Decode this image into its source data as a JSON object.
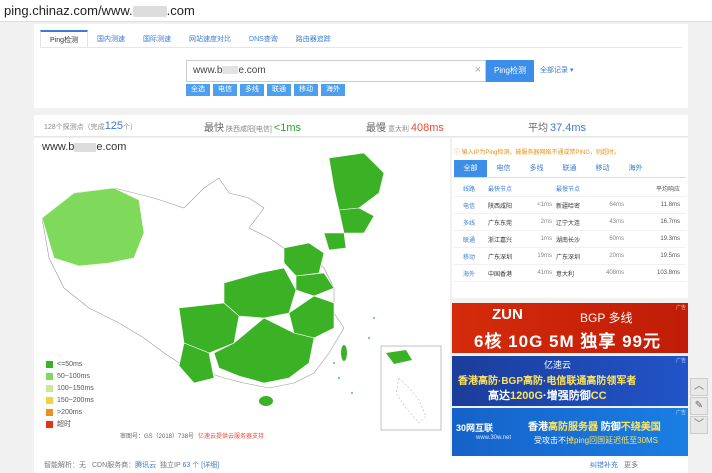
{
  "browser": {
    "url_prefix": "ping.chinaz.com/www.",
    "url_suffix": ".com"
  },
  "tabs": [
    "Ping检测",
    "国内测速",
    "国际测速",
    "网站速度对比",
    "DNS查询",
    "路由器追踪"
  ],
  "search": {
    "value_prefix": "www.b",
    "value_suffix": "e.com",
    "clear_icon": "×",
    "button": "Ping检测",
    "history": "全部记录 ▾"
  },
  "filters": [
    "全选",
    "电信",
    "多线",
    "联通",
    "移动",
    "海外"
  ],
  "stats": {
    "probe_prefix": "128个探测点（完成",
    "probe_count": "125",
    "probe_suffix": "个）",
    "fastest_label": "最快",
    "fastest_loc": "陕西咸阳[电信]",
    "fastest_val": "<1ms",
    "slowest_label": "最慢",
    "slowest_loc": "意大利",
    "slowest_val": "408ms",
    "avg_label": "平均",
    "avg_val": "37.4ms"
  },
  "map": {
    "host_prefix": "www.b",
    "host_suffix": "e.com",
    "legend": [
      {
        "label": "<=50ms",
        "color": "#3bb226"
      },
      {
        "label": "50~100ms",
        "color": "#7fd95a"
      },
      {
        "label": "100~150ms",
        "color": "#c6ea95"
      },
      {
        "label": "150~200ms",
        "color": "#f3d23d"
      },
      {
        "label": ">200ms",
        "color": "#f08e1c"
      },
      {
        "label": "超时",
        "color": "#e5331b"
      }
    ],
    "credit": "审图号：GS（2018）738号",
    "credit2": "亿速云提供云服务器支持"
  },
  "side": {
    "note": "输入IP为Ping检测，被服务器网络不通或禁PING，则超时。",
    "isp_tabs": [
      "全部",
      "电信",
      "多线",
      "联通",
      "移动",
      "海外"
    ],
    "columns": [
      "线路",
      "最快节点",
      "",
      "最慢节点",
      "",
      "平均响应"
    ],
    "rows": [
      [
        "电信",
        "陕西咸阳",
        "<1ms",
        "新疆哈密",
        "64ms",
        "11.8ms"
      ],
      [
        "多线",
        "广东东莞",
        "2ms",
        "辽宁大连",
        "43ms",
        "16.7ms"
      ],
      [
        "联通",
        "浙江嘉兴",
        "1ms",
        "湖南长沙",
        "60ms",
        "19.3ms"
      ],
      [
        "移动",
        "广东深圳",
        "19ms",
        "广东深圳",
        "20ms",
        "19.5ms"
      ],
      [
        "海外",
        "中国香港",
        "41ms",
        "意大利",
        "408ms",
        "103.8ms"
      ]
    ]
  },
  "ads": {
    "ad1_l1": "ZUN",
    "ad1_l1b": "BGP 多线",
    "ad1_l2": "6核 10G 5M 独享 99元",
    "ad2_l1": "亿速云",
    "ad2_l2": "香港高防·BGP高防·电信联通高防领军者",
    "ad2_l3a": "高达",
    "ad2_l3b": "1200G",
    "ad2_l3c": "·增强防御",
    "ad2_l3d": "CC",
    "ad3_logo": "30网互联",
    "ad3_sub": "www.30w.net",
    "ad3_l1a": "香港",
    "ad3_l1b": "高防服务器",
    "ad3_l1c": " 防御",
    "ad3_l1d": "不绕美国",
    "ad3_l2a": "受攻击不",
    "ad3_l2b": "掉ping回国延迟低至30MS",
    "tag": "广告"
  },
  "footer": {
    "smart": "智能解析：无",
    "cdn": "CDN服务商：",
    "cdn_val": "腾讯云",
    "ip": "独立IP",
    "ip_count": "63",
    "ip_unit": "个",
    "detail": "[详细]",
    "suggest": "纠错补充",
    "more": "更多"
  },
  "scroll": {
    "up_icon": "︿",
    "feedback_icon": "✎",
    "down_icon": "﹀"
  }
}
